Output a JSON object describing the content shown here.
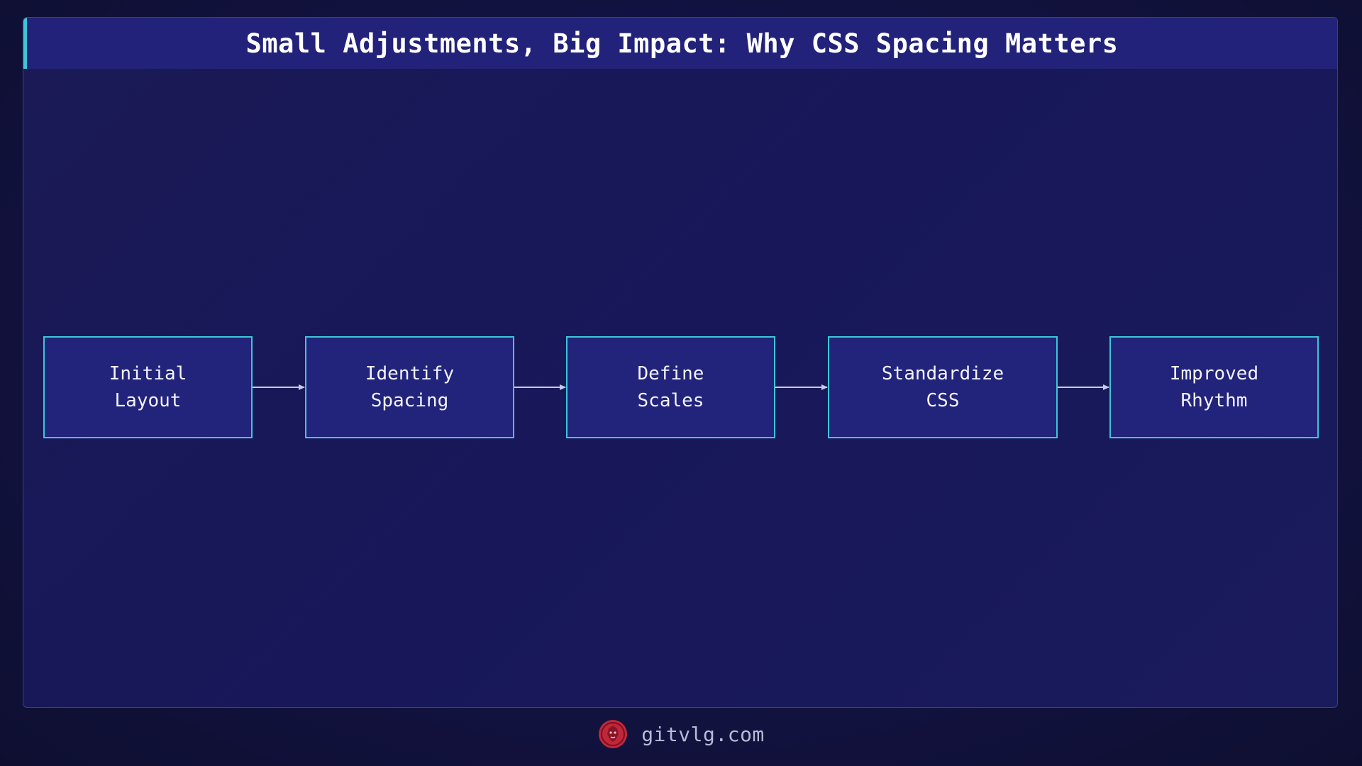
{
  "title": "Small Adjustments, Big Impact: Why CSS Spacing Matters",
  "nodes": [
    {
      "id": "initial-layout",
      "label": "Initial\nLayout"
    },
    {
      "id": "identify-spacing",
      "label": "Identify\nSpacing"
    },
    {
      "id": "define-scales",
      "label": "Define\nScales"
    },
    {
      "id": "standardize-css",
      "label": "Standardize\nCSS"
    },
    {
      "id": "improved-rhythm",
      "label": "Improved\nRhythm"
    }
  ],
  "edges": [
    {
      "from": "initial-layout",
      "to": "identify-spacing"
    },
    {
      "from": "identify-spacing",
      "to": "define-scales"
    },
    {
      "from": "define-scales",
      "to": "standardize-css"
    },
    {
      "from": "standardize-css",
      "to": "improved-rhythm"
    }
  ],
  "footer": {
    "site": "gitvlg.com",
    "logo_icon": "lion-logo-icon"
  },
  "colors": {
    "accent": "#3ec6d6",
    "node_fill": "#22237a",
    "logo": "#c0283a"
  }
}
